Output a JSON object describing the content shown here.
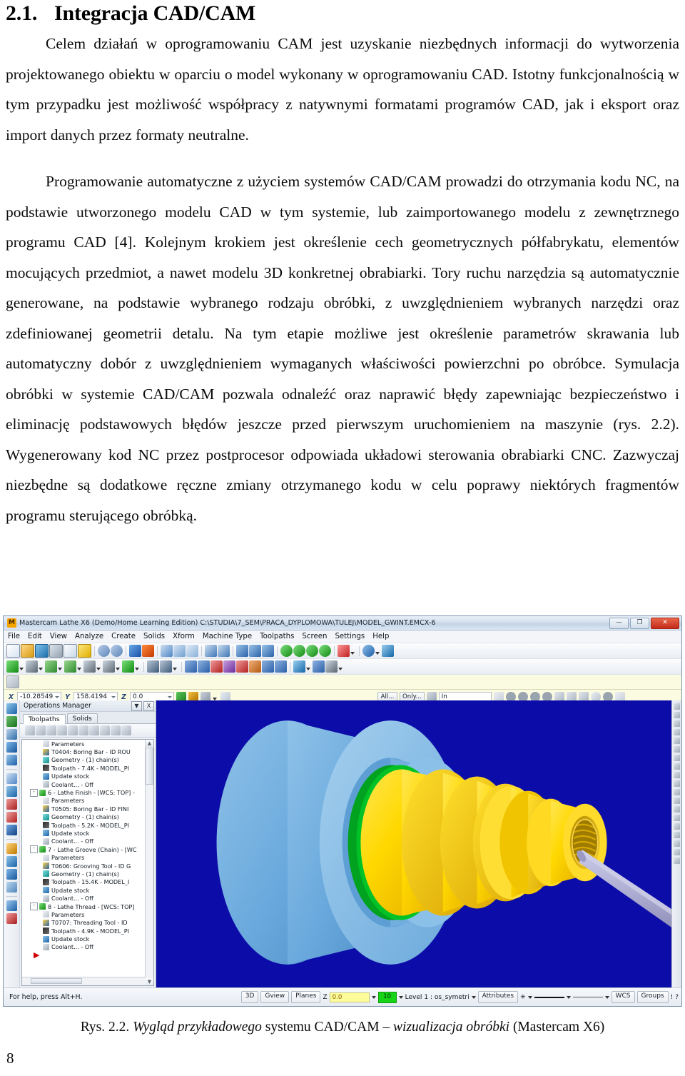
{
  "document": {
    "heading_number": "2.1.",
    "heading_title": "Integracja CAD/CAM",
    "paragraph_1": "Celem działań w oprogramowaniu CAM jest uzyskanie niezbędnych informacji do wytworzenia projektowanego obiektu w oparciu o model wykonany w oprogramowaniu CAD. Istotny funkcjonalnością w tym przypadku jest możliwość współpracy z natywnymi formatami programów CAD, jak i eksport oraz import danych przez formaty neutralne.",
    "paragraph_2": "Programowanie automatyczne z użyciem systemów CAD/CAM prowadzi do otrzymania kodu NC, na podstawie utworzonego modelu CAD w tym systemie, lub zaimportowanego modelu z zewnętrznego programu CAD [4]. Kolejnym krokiem jest określenie cech geometrycznych półfabrykatu, elementów mocujących przedmiot, a nawet modelu 3D konkretnej obrabiarki. Tory ruchu narzędzia są automatycznie generowane, na podstawie wybranego rodzaju obróbki, z uwzględnieniem wybranych narzędzi oraz zdefiniowanej geometrii detalu. Na tym etapie możliwe jest określenie parametrów skrawania lub automatyczny dobór z uwzględnieniem wymaganych właściwości powierzchni po obróbce. Symulacja obróbki w systemie CAD/CAM pozwala odnaleźć oraz naprawić błędy zapewniając bezpieczeństwo i eliminację podstawowych błędów jeszcze przed pierwszym uruchomieniem na maszynie (rys. 2.2). Wygenerowany kod NC przez postprocesor odpowiada układowi sterowania obrabiarki CNC. Zazwyczaj niezbędne są dodatkowe ręczne zmiany otrzymanego kodu w celu poprawy niektórych fragmentów programu sterującego obróbką.",
    "caption_prefix": "Rys. 2.2. ",
    "caption_i1": "Wygląd przykładowego",
    "caption_mid": " systemu CAD/CAM – ",
    "caption_i2": "wizualizacja obróbki",
    "caption_suffix": " (Mastercam X6)",
    "page_number": "8"
  },
  "app": {
    "window_title": "Mastercam Lathe X6 (Demo/Home Learning Edition)  C:\\STUDIA\\7_SEM\\PRACA_DYPLOMOWA\\TULEJ\\MODEL_GWINT.EMCX-6",
    "app_icon": "M",
    "window_controls": {
      "minimize": "—",
      "maximize": "❐",
      "close": "✕"
    },
    "menu": [
      "File",
      "Edit",
      "View",
      "Analyze",
      "Create",
      "Solids",
      "Xform",
      "Machine Type",
      "Toolpaths",
      "Screen",
      "Settings",
      "Help"
    ],
    "coordbar": {
      "x_label": "X",
      "x_value": "-10.28549",
      "y_label": "Y",
      "y_value": "158.4194",
      "z_label": "Z",
      "z_value": "0.0",
      "all_button": "All...",
      "only_button": "Only...",
      "selection_mode": "In"
    },
    "operations_manager": {
      "title": "Operations Manager",
      "collapse_btn": "▼",
      "close_btn": "X",
      "tabs": [
        {
          "label": "Toolpaths",
          "active": true
        },
        {
          "label": "Solids",
          "active": false
        }
      ],
      "tree": [
        {
          "depth": 3,
          "icon": "params",
          "label": "Parameters",
          "expander": ""
        },
        {
          "depth": 3,
          "icon": "tool",
          "label": "T0404: Boring Bar - ID ROU",
          "expander": ""
        },
        {
          "depth": 3,
          "icon": "geom",
          "label": "Geometry - (1) chain(s)",
          "expander": ""
        },
        {
          "depth": 3,
          "icon": "path",
          "label": "Toolpath - 7.4K - MODEL_PI",
          "expander": ""
        },
        {
          "depth": 3,
          "icon": "stock",
          "label": "Update stock",
          "expander": ""
        },
        {
          "depth": 3,
          "icon": "cool",
          "label": "Coolant... - Off",
          "expander": ""
        },
        {
          "depth": 1,
          "icon": "op",
          "label": "6 - Lathe Finish - [WCS: TOP] -",
          "expander": "-"
        },
        {
          "depth": 3,
          "icon": "params",
          "label": "Parameters",
          "expander": ""
        },
        {
          "depth": 3,
          "icon": "tool",
          "label": "T0505: Boring Bar - ID FINI",
          "expander": ""
        },
        {
          "depth": 3,
          "icon": "geom",
          "label": "Geometry - (1) chain(s)",
          "expander": ""
        },
        {
          "depth": 3,
          "icon": "path",
          "label": "Toolpath - 5.2K - MODEL_PI",
          "expander": ""
        },
        {
          "depth": 3,
          "icon": "stock",
          "label": "Update stock",
          "expander": ""
        },
        {
          "depth": 3,
          "icon": "cool",
          "label": "Coolant... - Off",
          "expander": ""
        },
        {
          "depth": 1,
          "icon": "op",
          "label": "7 - Lathe Groove (Chain) - [WC",
          "expander": "-"
        },
        {
          "depth": 3,
          "icon": "params",
          "label": "Parameters",
          "expander": ""
        },
        {
          "depth": 3,
          "icon": "tool",
          "label": "T0606: Grooving Tool - ID G",
          "expander": ""
        },
        {
          "depth": 3,
          "icon": "geom",
          "label": "Geometry - (1) chain(s)",
          "expander": ""
        },
        {
          "depth": 3,
          "icon": "path",
          "label": "Toolpath - 15.4K - MODEL_I",
          "expander": ""
        },
        {
          "depth": 3,
          "icon": "stock",
          "label": "Update stock",
          "expander": ""
        },
        {
          "depth": 3,
          "icon": "cool",
          "label": "Coolant... - Off",
          "expander": ""
        },
        {
          "depth": 1,
          "icon": "op",
          "label": "8 - Lathe Thread - [WCS: TOP]",
          "expander": "-"
        },
        {
          "depth": 3,
          "icon": "params",
          "label": "Parameters",
          "expander": ""
        },
        {
          "depth": 3,
          "icon": "tool",
          "label": "T0707: Threading Tool - ID",
          "expander": ""
        },
        {
          "depth": 3,
          "icon": "path",
          "label": "Toolpath - 4.9K - MODEL_PI",
          "expander": ""
        },
        {
          "depth": 3,
          "icon": "stock",
          "label": "Update stock",
          "expander": ""
        },
        {
          "depth": 3,
          "icon": "cool",
          "label": "Coolant... - Off",
          "expander": ""
        }
      ]
    },
    "statusbar": {
      "help_text": "For help, press Alt+H.",
      "view_3d": "3D",
      "gview": "Gview",
      "planes": "Planes",
      "z_label": "Z",
      "z_value": "0.0",
      "level_number": "10",
      "level_label": "Level",
      "level_value": "1 : os_symetri",
      "attributes": "Attributes",
      "wcs": "WCS",
      "groups": "Groups",
      "alert": "!",
      "help_q": "?"
    },
    "colors": {
      "viewport_background": "#0c0ca8",
      "part_yellow": "#ffd800",
      "stock_blue": "#6aa9dd",
      "groove_green": "#00a21f",
      "tool_lavender": "#aeaed4",
      "prompt_yellow": "#fbfbe2",
      "level_green": "#17d417"
    }
  }
}
